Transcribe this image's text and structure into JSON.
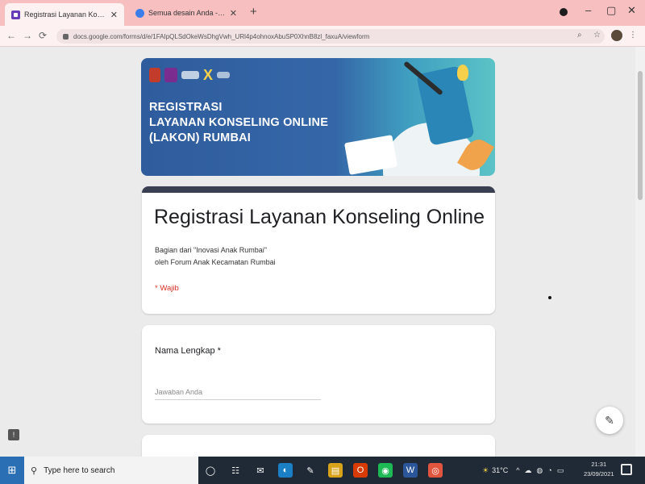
{
  "browser": {
    "tabs": [
      {
        "title": "Registrasi Layanan Konseling O",
        "active": true
      },
      {
        "title": "Semua desain Anda - Canva",
        "active": false
      }
    ],
    "new_tab": "+",
    "tab_close": "✕",
    "window_controls": {
      "minimize": "–",
      "maximize": "▢",
      "close": "✕"
    },
    "nav": {
      "back": "←",
      "forward": "→",
      "reload": "⟳"
    },
    "url": "docs.google.com/forms/d/e/1FAIpQLSdOkeWsDhgVwh_URl4p4ohnoxAbuSP0XhnB8zl_faxuA/viewform",
    "url_icons": {
      "zoom": "⌕",
      "star": "☆",
      "menu": "⋮"
    }
  },
  "banner": {
    "headline_lines": [
      "REGISTRASI",
      "LAYANAN KONSELING ONLINE",
      "(LAKON) RUMBAI"
    ]
  },
  "form": {
    "title": "Registrasi Layanan Konseling Online",
    "description_line1": "Bagian dari \"Inovasi Anak Rumbai\"",
    "description_line2": "oleh Forum Anak Kecamatan Rumbai",
    "required_note": "* Wajib",
    "question1": {
      "label": "Nama Lengkap *",
      "placeholder": "Jawaban Anda",
      "value": ""
    }
  },
  "fab": {
    "edit_glyph": "✎"
  },
  "feedback_glyph": "!",
  "taskbar": {
    "start_glyph": "⊞",
    "search_placeholder": "Type here to search",
    "search_glyph": "⚲",
    "temperature": "31°C",
    "time": "21:31",
    "date": "23/09/2021",
    "apps": [
      {
        "name": "task-view",
        "glyph": "◯",
        "color": "#1f2a36"
      },
      {
        "name": "widgets",
        "glyph": "☷",
        "color": "#1f2a36"
      },
      {
        "name": "mail",
        "glyph": "✉",
        "color": "#1f2a36"
      },
      {
        "name": "edge",
        "glyph": "◐",
        "color": "#1a7fc4"
      },
      {
        "name": "pen",
        "glyph": "✎",
        "color": "#1f2a36"
      },
      {
        "name": "files",
        "glyph": "▤",
        "color": "#d8a21a"
      },
      {
        "name": "office",
        "glyph": "O",
        "color": "#d83b01"
      },
      {
        "name": "spotify",
        "glyph": "◉",
        "color": "#1db954"
      },
      {
        "name": "word",
        "glyph": "W",
        "color": "#2b579a"
      },
      {
        "name": "chrome",
        "glyph": "◎",
        "color": "#e0553e"
      }
    ],
    "tray_glyphs": {
      "weather": "☀",
      "chevron": "^",
      "network": "◍",
      "volume": "◔",
      "battery": "▭",
      "onedrive": "☁"
    }
  },
  "colors": {
    "tab_strip": "#f7bfc0",
    "banner_left": "#2f5c9c",
    "banner_right": "#5bc3c6",
    "form_accent": "#3a3f52",
    "required_red": "#d93025"
  }
}
